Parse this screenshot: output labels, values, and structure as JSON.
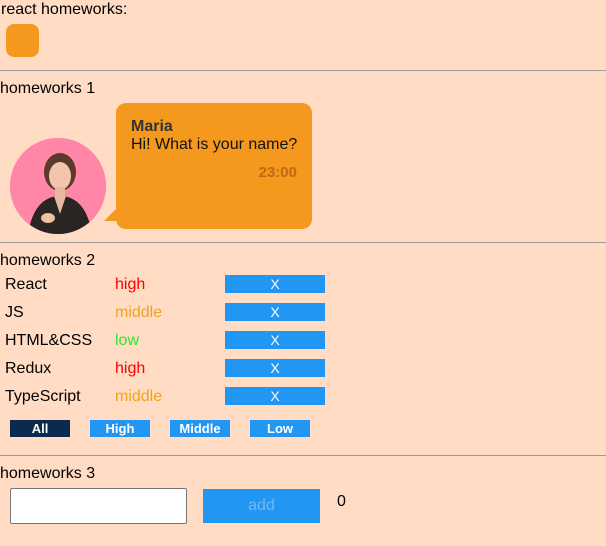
{
  "app": {
    "title": "react homeworks:",
    "accent_color": "#f4991e"
  },
  "hw1": {
    "title": "homeworks 1",
    "message": {
      "name": "Maria",
      "text": "Hi! What is your name?",
      "time": "23:00"
    }
  },
  "hw2": {
    "title": "homeworks 2",
    "affairs": [
      {
        "name": "React",
        "priority": "high",
        "color": "#ff0000",
        "delete_label": "X"
      },
      {
        "name": "JS",
        "priority": "middle",
        "color": "#f4a21e",
        "delete_label": "X"
      },
      {
        "name": "HTML&CSS",
        "priority": "low",
        "color": "#2ee62e",
        "delete_label": "X"
      },
      {
        "name": "Redux",
        "priority": "high",
        "color": "#ff0000",
        "delete_label": "X"
      },
      {
        "name": "TypeScript",
        "priority": "middle",
        "color": "#f4a21e",
        "delete_label": "X"
      }
    ],
    "filters": [
      "All",
      "High",
      "Middle",
      "Low"
    ],
    "active_filter": "All"
  },
  "hw3": {
    "title": "homeworks 3",
    "input_value": "",
    "add_label": "add",
    "count": "0"
  }
}
